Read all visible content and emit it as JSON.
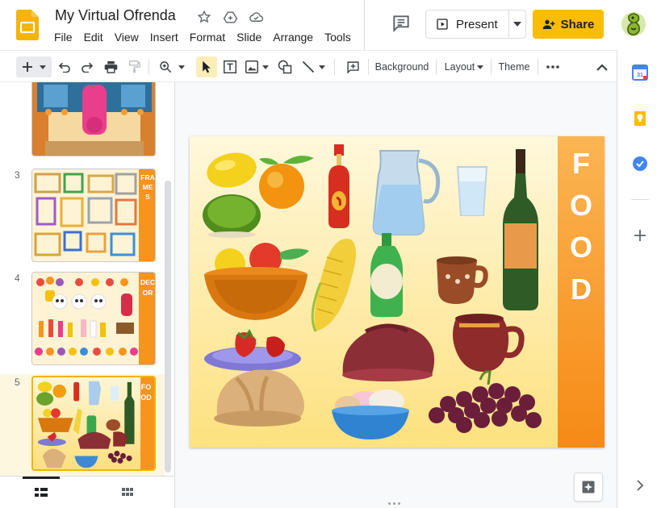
{
  "doc": {
    "title": "My Virtual Ofrenda"
  },
  "menu": [
    "File",
    "Edit",
    "View",
    "Insert",
    "Format",
    "Slide",
    "Arrange",
    "Tools"
  ],
  "header": {
    "present_label": "Present",
    "share_label": "Share"
  },
  "toolbar": {
    "background_label": "Background",
    "layout_label": "Layout",
    "theme_label": "Theme"
  },
  "thumbnails": [
    {
      "num": ""
    },
    {
      "num": "3",
      "side_text": "FRAMES"
    },
    {
      "num": "4",
      "side_text": "DECOR"
    },
    {
      "num": "5",
      "side_text": "FOOD"
    }
  ],
  "slide": {
    "side_text": "FOOD"
  },
  "colors": {
    "accent": "#fbbc04",
    "side_band": "#f7941d",
    "slide_bg": "#fde68a"
  },
  "icons": [
    "slides-logo-icon",
    "star-icon",
    "move-to-drive-icon",
    "cloud-saved-icon",
    "comment-icon",
    "present-icon",
    "share-person-icon",
    "calendar-icon",
    "keep-icon",
    "tasks-icon",
    "add-icon",
    "expand-panel-icon"
  ]
}
